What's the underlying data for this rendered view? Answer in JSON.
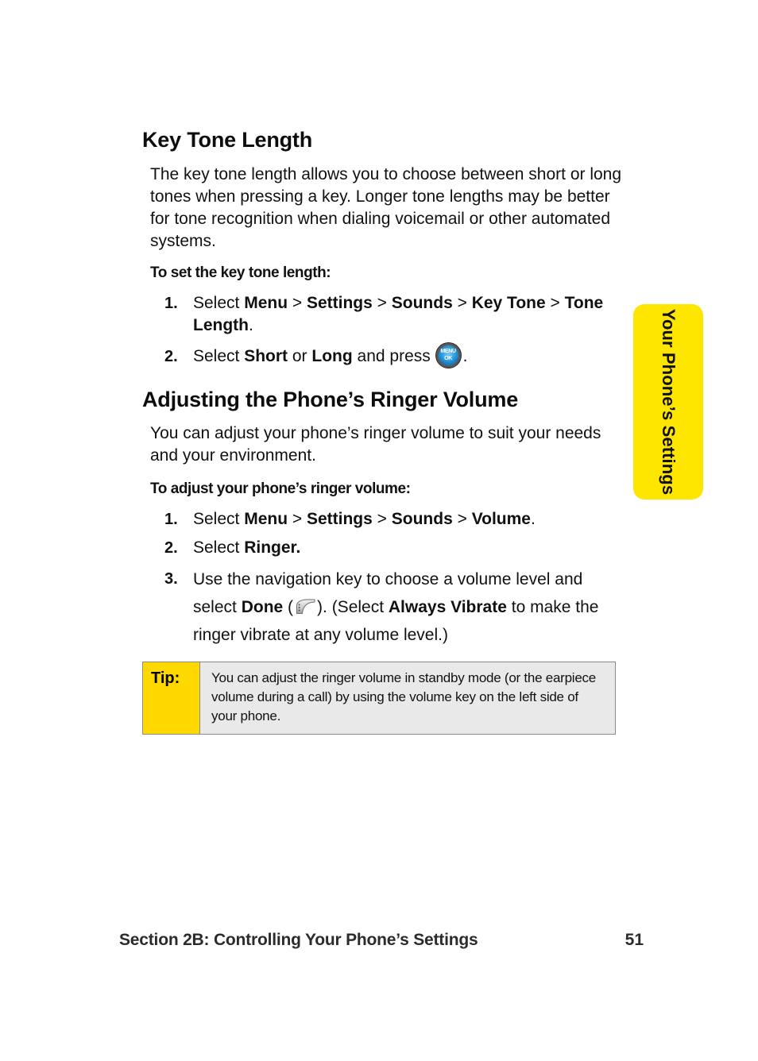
{
  "document": {
    "page_background": "#FFFFFF",
    "accent_yellow": "#FFE600",
    "tip_yellow": "#FFD800",
    "tip_gray": "#E9E9E9"
  },
  "side_tab": {
    "label": "Your Phone’s Settings",
    "color": "#FFE600"
  },
  "sections": [
    {
      "heading": "Key Tone Length",
      "paragraph": "The key tone length allows you to choose between short or long tones when pressing a key. Longer tone lengths may be better for tone recognition when dialing voicemail or other automated systems.",
      "lead_in": "To set the key tone length:",
      "steps": [
        {
          "number": "1.",
          "parts": [
            {
              "t": "Select ",
              "b": false
            },
            {
              "t": "Menu",
              "b": true
            },
            {
              "t": " > ",
              "b": false
            },
            {
              "t": "Settings",
              "b": true
            },
            {
              "t": " > ",
              "b": false
            },
            {
              "t": "Sounds",
              "b": true
            },
            {
              "t": " > ",
              "b": false
            },
            {
              "t": "Key Tone",
              "b": true
            },
            {
              "t": " > ",
              "b": false
            },
            {
              "t": "Tone Length",
              "b": true
            },
            {
              "t": ".",
              "b": false
            }
          ]
        },
        {
          "number": "2.",
          "parts": [
            {
              "t": "Select ",
              "b": false
            },
            {
              "t": "Short",
              "b": true
            },
            {
              "t": " or ",
              "b": false
            },
            {
              "t": "Long",
              "b": true
            },
            {
              "t": " and press ",
              "b": false
            },
            {
              "icon": "menu-ok-key"
            },
            {
              "t": ".",
              "b": false
            }
          ]
        }
      ]
    },
    {
      "heading": "Adjusting the Phone’s Ringer Volume",
      "paragraph": "You can adjust your phone’s ringer volume to suit your needs and your environment.",
      "lead_in": "To adjust your phone’s ringer volume:",
      "steps": [
        {
          "number": "1.",
          "parts": [
            {
              "t": "Select ",
              "b": false
            },
            {
              "t": "Menu",
              "b": true
            },
            {
              "t": " > ",
              "b": false
            },
            {
              "t": "Settings",
              "b": true
            },
            {
              "t": " > ",
              "b": false
            },
            {
              "t": "Sounds",
              "b": true
            },
            {
              "t": " > ",
              "b": false
            },
            {
              "t": "Volume",
              "b": true
            },
            {
              "t": ".",
              "b": false
            }
          ]
        },
        {
          "number": "2.",
          "parts": [
            {
              "t": "Select ",
              "b": false
            },
            {
              "t": "Ringer.",
              "b": true
            }
          ]
        },
        {
          "number": "3.",
          "parts": [
            {
              "t": "Use the navigation key to choose a volume level and select ",
              "b": false
            },
            {
              "t": "Done",
              "b": true
            },
            {
              "t": " (",
              "b": false
            },
            {
              "icon": "softkey-done"
            },
            {
              "t": "). (Select ",
              "b": false
            },
            {
              "t": "Always Vibrate",
              "b": true
            },
            {
              "t": " to make the ringer vibrate at any volume level.)",
              "b": false
            }
          ]
        }
      ]
    }
  ],
  "tip": {
    "label": "Tip:",
    "body": "You can adjust the ringer volume in standby mode (or the earpiece volume during a call) by using the volume key on the left side of your phone."
  },
  "key_glyphs": {
    "menu_ok_top": "MENU",
    "menu_ok_bottom": "OK"
  },
  "footer": {
    "section": "Section 2B: Controlling Your Phone’s Settings",
    "page_number": "51"
  }
}
